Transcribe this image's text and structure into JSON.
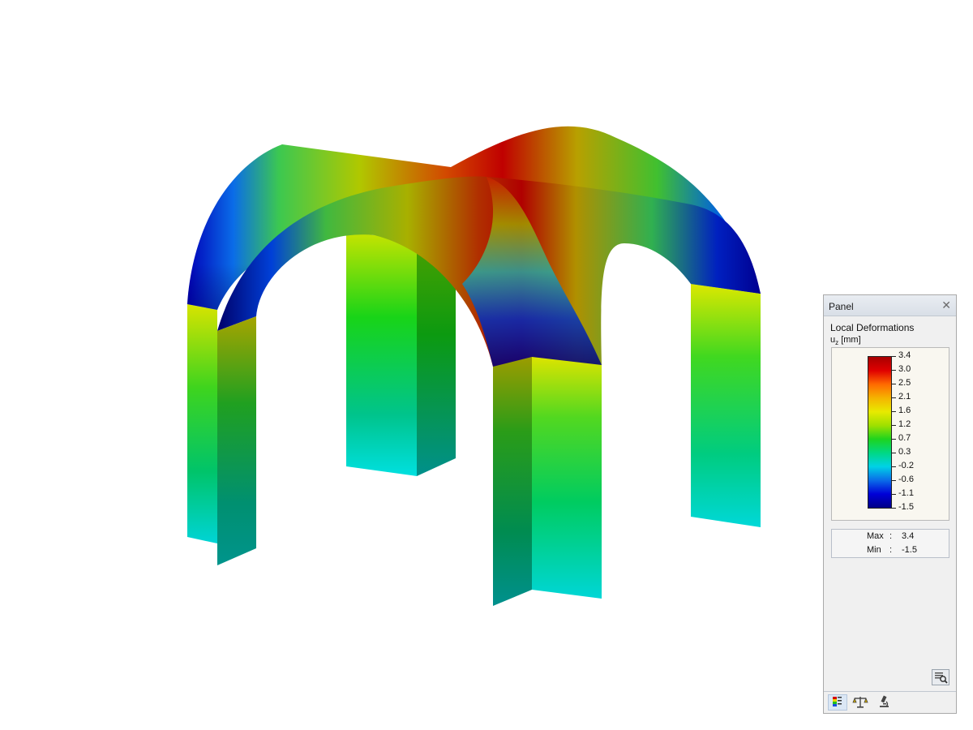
{
  "panel": {
    "title": "Panel",
    "close_icon": "close-icon",
    "result_title": "Local Deformations",
    "unit_symbol": "u",
    "unit_subscript": "z",
    "unit": "[mm]",
    "legend": {
      "values": [
        "3.4",
        "3.0",
        "2.5",
        "2.1",
        "1.6",
        "1.2",
        "0.7",
        "0.3",
        "-0.2",
        "-0.6",
        "-1.1",
        "-1.5"
      ],
      "colors": [
        "#a80000",
        "#e00000",
        "#ff6a00",
        "#f5b400",
        "#e8ea00",
        "#9ee000",
        "#1ed41e",
        "#00d884",
        "#00d2e6",
        "#0a6ce8",
        "#0000d8",
        "#000088"
      ]
    },
    "max_label": "Max",
    "max_value": "3.4",
    "min_label": "Min",
    "min_value": "-1.5",
    "colon": ":",
    "toolbar_icons": [
      "color-scale-icon",
      "balance-icon",
      "microscope-icon"
    ],
    "zoom_icon": "magnify-icon"
  }
}
